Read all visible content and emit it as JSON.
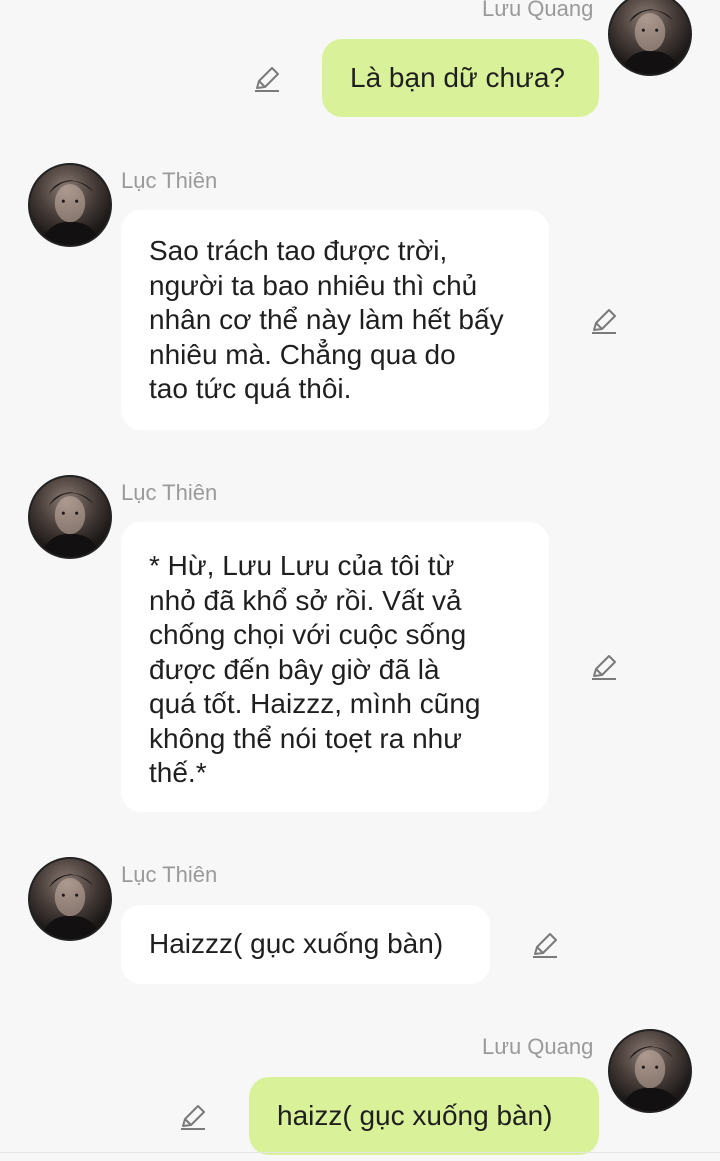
{
  "messages": [
    {
      "sender": "Lưu Quang",
      "side": "right",
      "lines": [
        "Là bạn dữ chưa?"
      ]
    },
    {
      "sender": "Lục Thiên",
      "side": "left",
      "lines": [
        "Sao trách tao được trời,",
        "người ta bao nhiêu thì chủ",
        "nhân cơ thể này làm hết bấy",
        "nhiêu mà. Chẳng qua do",
        "tao tức quá thôi."
      ]
    },
    {
      "sender": "Lục Thiên",
      "side": "left",
      "lines": [
        "* Hừ, Lưu Lưu của tôi từ",
        "nhỏ đã khổ sở rồi. Vất vả",
        "chống chọi với cuộc sống",
        "được đến bây giờ đã là",
        "quá tốt. Haizzz, mình cũng",
        "không thể nói toẹt ra như",
        "thế.*"
      ]
    },
    {
      "sender": "Lục Thiên",
      "side": "left",
      "lines": [
        "Haizzz( gục xuống bàn)"
      ]
    },
    {
      "sender": "Lưu Quang",
      "side": "right",
      "lines": [
        "haizz( gục xuống bàn)"
      ]
    }
  ],
  "icons": {
    "edit": "pencil-edit-icon",
    "avatar": "user-avatar"
  },
  "colors": {
    "background": "#f7f7f7",
    "my_bubble": "#d9f29a",
    "their_bubble": "#ffffff",
    "name_text": "#9a9a9a",
    "message_text": "#1f1f1f"
  }
}
